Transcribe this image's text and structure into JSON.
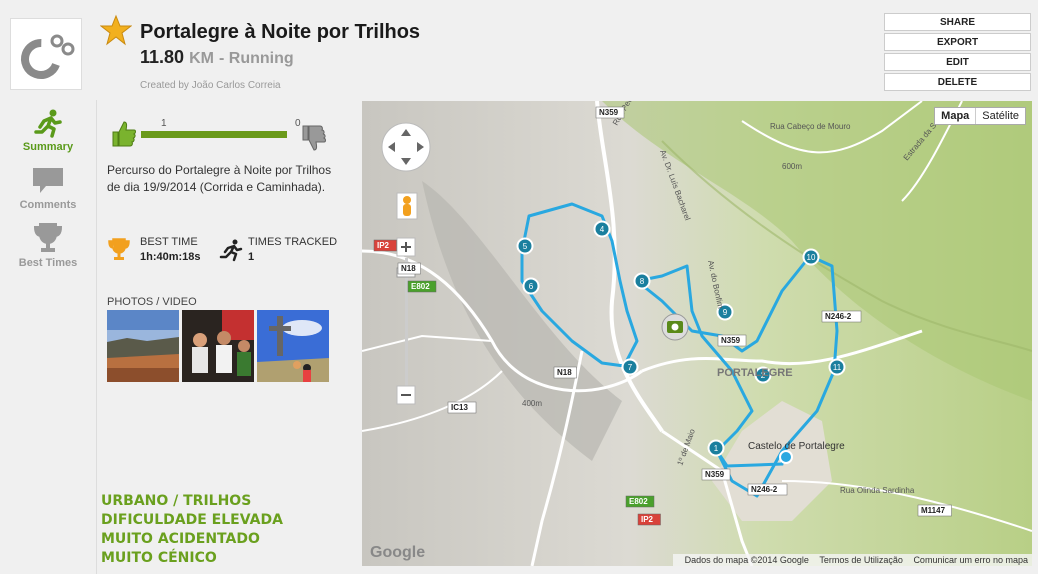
{
  "activity": {
    "title": "Portalegre à Noite por Trilhos",
    "distance": "11.80",
    "unit": "KM",
    "sport": "- Running",
    "created_by": "Created by João Carlos Correia"
  },
  "actions": {
    "share": "SHARE",
    "export": "EXPORT",
    "edit": "EDIT",
    "delete": "DELETE"
  },
  "nav": {
    "summary": "Summary",
    "comments": "Comments",
    "best_times": "Best Times"
  },
  "rating": {
    "likes": "1",
    "dislikes": "0",
    "like_fraction": 1.0
  },
  "description": "Percurso do Portalegre à Noite por Trilhos de dia 19/9/2014 (Corrida e Caminhada).",
  "stats": {
    "best_time_label": "BEST TIME",
    "best_time_value": "1h:40m:18s",
    "times_tracked_label": "TIMES TRACKED",
    "times_tracked_value": "1"
  },
  "photos_label": "PHOTOS / VIDEO",
  "tags": [
    "URBANO / TRILHOS",
    "DIFICULDADE ELEVADA",
    "MUITO ACIDENTADO",
    "MUITO CÉNICO"
  ],
  "map": {
    "type_map": "Mapa",
    "type_satellite": "Satélite",
    "attribution": "Dados do mapa ©2014 Google",
    "terms": "Termos de Utilização",
    "report": "Comunicar um erro no mapa",
    "google": "Google",
    "town": "PORTALEGRE",
    "castle": "Castelo de Portalegre",
    "street_1": "Rua Cabeço de Mouro",
    "street_2": "Estrada da Serra",
    "street_3": "Av. Dr. Luís Bacharel",
    "street_4": "Av. do Bonfim",
    "street_5": "1º de Maio",
    "street_6": "Rua Olinda Sardinha",
    "street_7": "Rua Pedro",
    "elev_1": "600m",
    "elev_2": "400m",
    "roads": [
      "N359",
      "IP2",
      "N18",
      "E802",
      "IC13",
      "N246-2",
      "M1147",
      "N359",
      "N359",
      "E802",
      "IP2",
      "N246-2",
      "N18"
    ],
    "markers": [
      "1",
      "2",
      "4",
      "5",
      "6",
      "7",
      "8",
      "9",
      "10",
      "11"
    ]
  }
}
